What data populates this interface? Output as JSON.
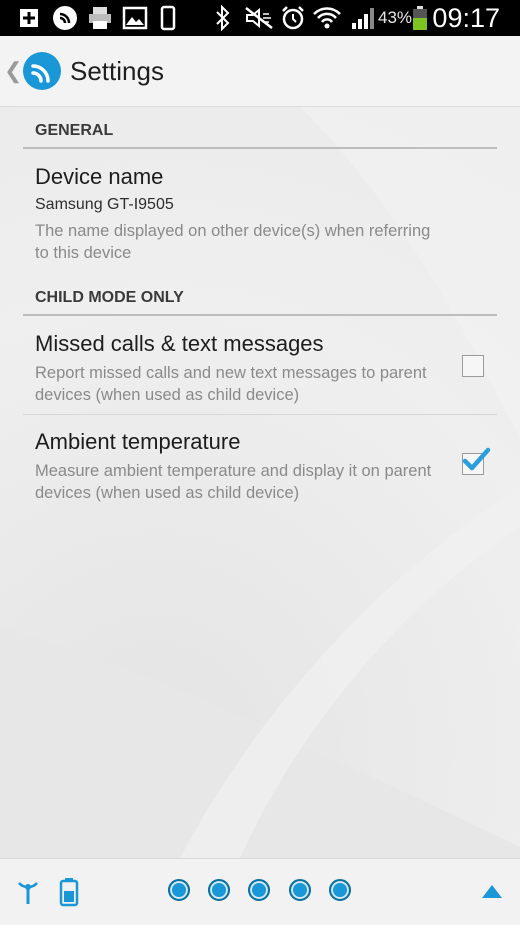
{
  "status_bar": {
    "battery_percent": "43%",
    "time": "09:17",
    "icons": [
      "add-icon",
      "app-logo-icon",
      "printer-icon",
      "image-icon",
      "phone-icon",
      "bluetooth-icon",
      "mute-icon",
      "alarm-icon",
      "wifi-icon",
      "signal-icon",
      "battery-icon"
    ]
  },
  "action_bar": {
    "title": "Settings",
    "back_icon": "chevron-left-icon",
    "app_icon": "app-logo-icon"
  },
  "sections": [
    {
      "header": "GENERAL",
      "prefs": [
        {
          "title": "Device name",
          "value": "Samsung GT-I9505",
          "summary": "The name displayed on other device(s) when referring to this device"
        }
      ]
    },
    {
      "header": "CHILD MODE ONLY",
      "prefs": [
        {
          "title": "Missed calls & text messages",
          "summary": "Report missed calls and new text messages to parent devices (when used as child device)",
          "checked": false
        },
        {
          "title": "Ambient temperature",
          "summary": "Measure ambient temperature and display it on parent devices (when used as child device)",
          "checked": true
        }
      ]
    }
  ],
  "bottom_bar": {
    "left_icons": [
      "antenna-icon",
      "battery-status-icon"
    ],
    "page_dots": 5,
    "right_icon": "expand-up-icon"
  },
  "colors": {
    "accent": "#1a97d6",
    "check": "#2a9fe0"
  }
}
